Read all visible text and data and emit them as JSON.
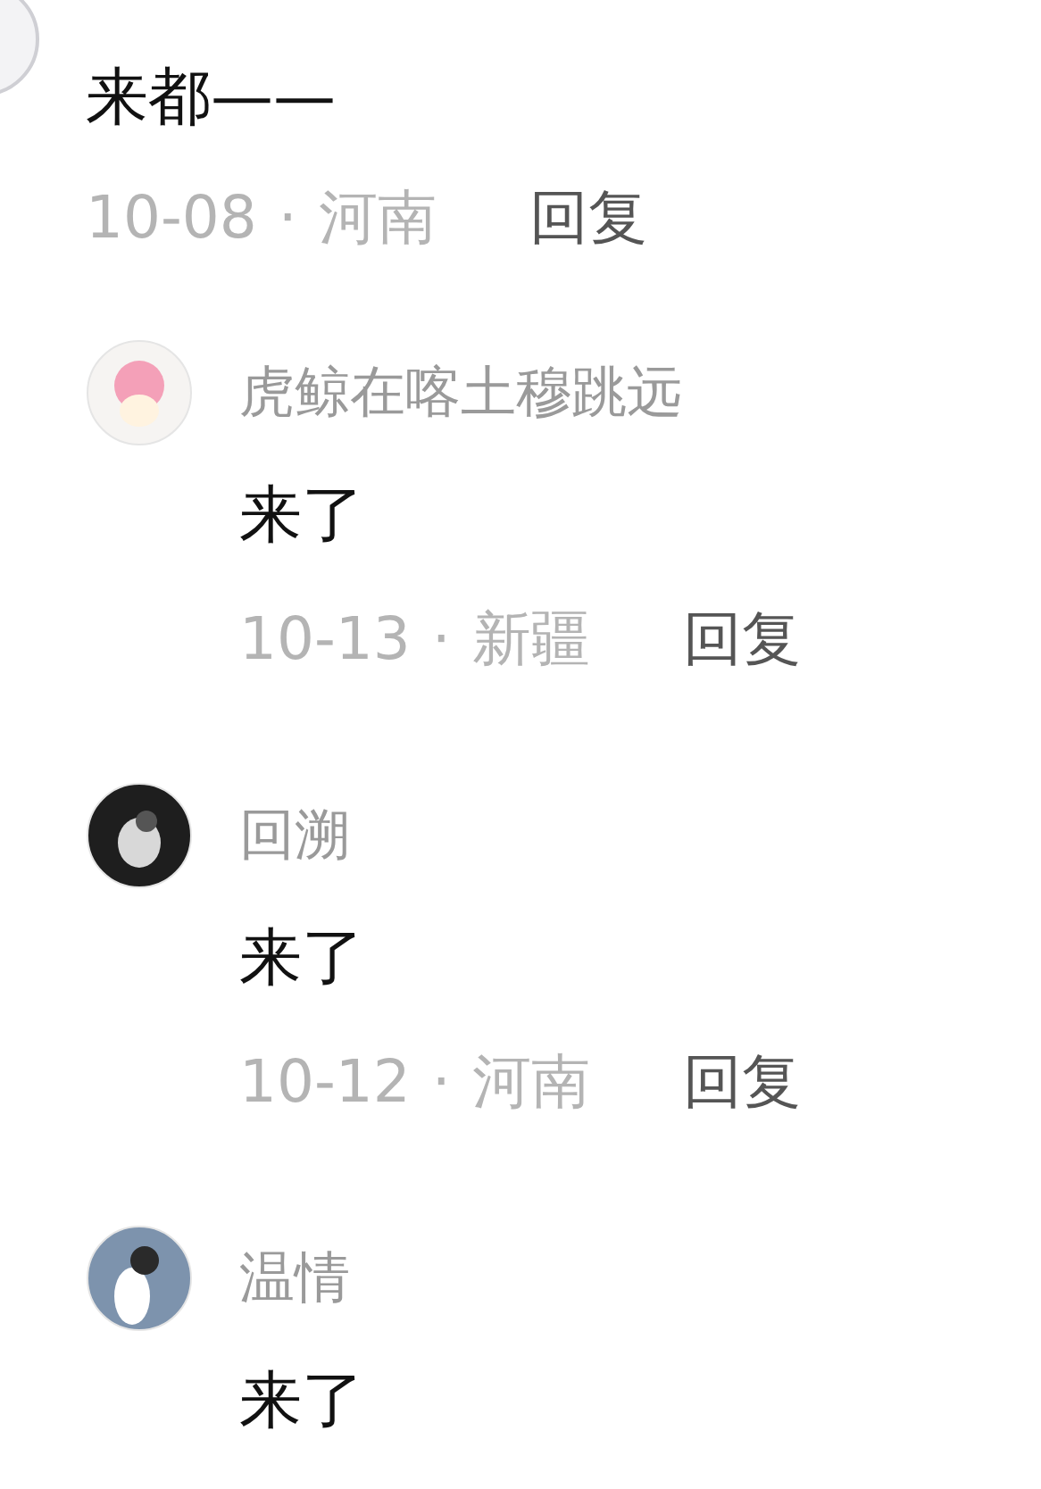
{
  "comment": {
    "text": "来都——",
    "date": "10-08",
    "separator": "·",
    "location": "河南",
    "reply_label": "回复"
  },
  "replies": [
    {
      "name": "虎鲸在喀土穆跳远",
      "text": "来了",
      "date": "10-13",
      "separator": "·",
      "location": "新疆",
      "reply_label": "回复",
      "kind": "pink"
    },
    {
      "name": "回溯",
      "text": "来了",
      "date": "10-12",
      "separator": "·",
      "location": "河南",
      "reply_label": "回复",
      "kind": "dark"
    },
    {
      "name": "温情",
      "text": "来了",
      "kind": "light"
    }
  ]
}
